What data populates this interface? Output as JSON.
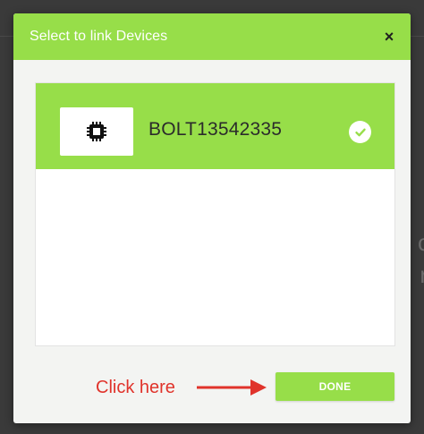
{
  "modal": {
    "title": "Select to link Devices",
    "close_label": "×"
  },
  "devices": [
    {
      "name": "BOLT13542335",
      "icon": "chip-icon",
      "selected": true
    }
  ],
  "annotation": {
    "text": "Click here",
    "arrow_icon": "right-arrow-icon"
  },
  "actions": {
    "done_label": "DONE"
  },
  "colors": {
    "accent": "#97de49",
    "annotation": "#e0332b",
    "overlay": "#3a3a3a"
  }
}
